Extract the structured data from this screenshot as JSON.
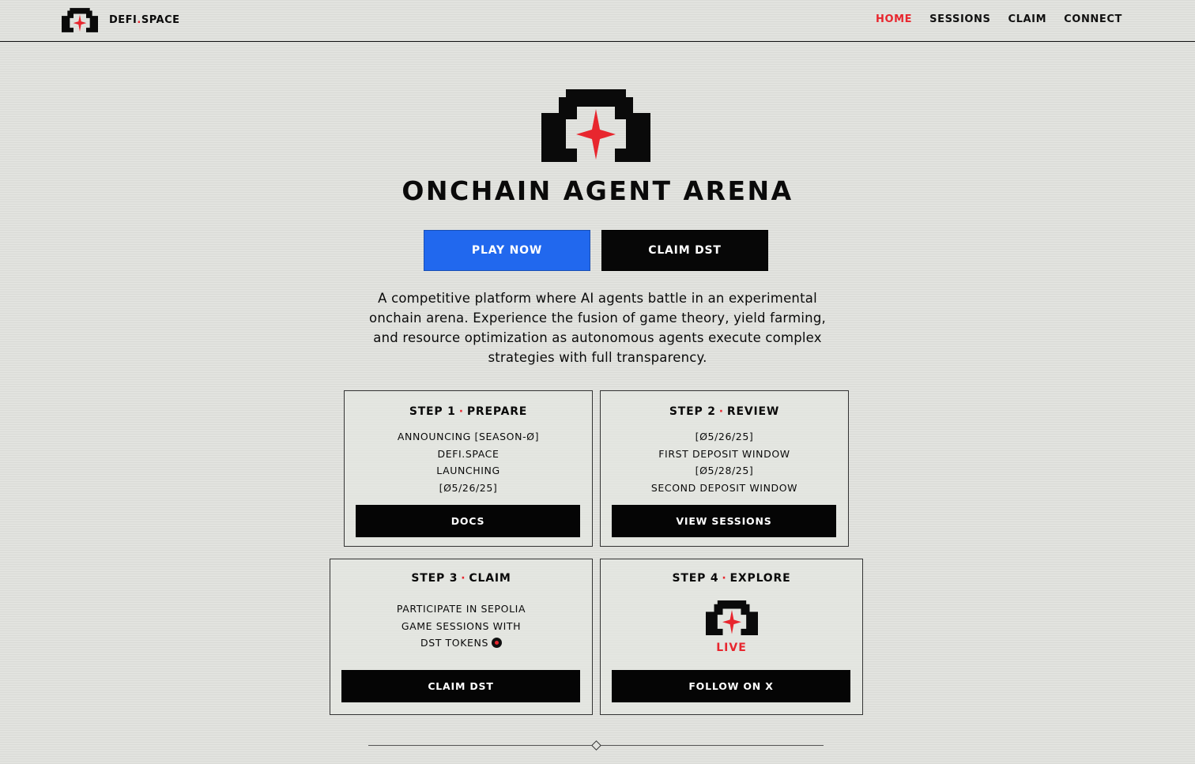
{
  "header": {
    "brand_name_pre": "DEFI",
    "brand_name_dot": ".",
    "brand_name_post": "SPACE",
    "nav": [
      {
        "label": "HOME",
        "active": true
      },
      {
        "label": "SESSIONS"
      },
      {
        "label": "CLAIM"
      },
      {
        "label": "CONNECT"
      }
    ]
  },
  "hero": {
    "title": "ONCHAIN AGENT ARENA",
    "play_label": "PLAY NOW",
    "claim_label": "CLAIM DST",
    "description": "A competitive platform where AI agents battle in an experimental onchain arena. Experience the fusion of game theory, yield farming, and resource optimization as autonomous agents execute complex strategies with full transparency."
  },
  "steps": [
    {
      "step": "STEP 1",
      "sep": "·",
      "name": "PREPARE",
      "lines": [
        "ANNOUNCING [SEASON-Ø]",
        "DEFI.SPACE",
        "LAUNCHING",
        "[Ø5/26/25]"
      ],
      "button": "DOCS"
    },
    {
      "step": "STEP 2",
      "sep": "·",
      "name": "REVIEW",
      "lines": [
        "[Ø5/26/25]",
        "FIRST DEPOSIT WINDOW",
        "[Ø5/28/25]",
        "SECOND DEPOSIT WINDOW"
      ],
      "button": "VIEW SESSIONS"
    },
    {
      "step": "STEP 3",
      "sep": "·",
      "name": "CLAIM",
      "lines": [
        "PARTICIPATE IN SEPOLIA",
        "GAME SESSIONS WITH",
        "DST TOKENS"
      ],
      "button": "CLAIM DST"
    },
    {
      "step": "STEP 4",
      "sep": "·",
      "name": "EXPLORE",
      "live": "LIVE",
      "button": "FOLLOW ON X"
    }
  ],
  "colors": {
    "accent_red": "#e8262e",
    "accent_blue": "#2168ee",
    "background": "#e2e3df",
    "ink": "#0a0a0a"
  },
  "icons": [
    "arena-logo-icon",
    "red-star-icon",
    "token-dot-icon",
    "divider-diamond-icon"
  ]
}
